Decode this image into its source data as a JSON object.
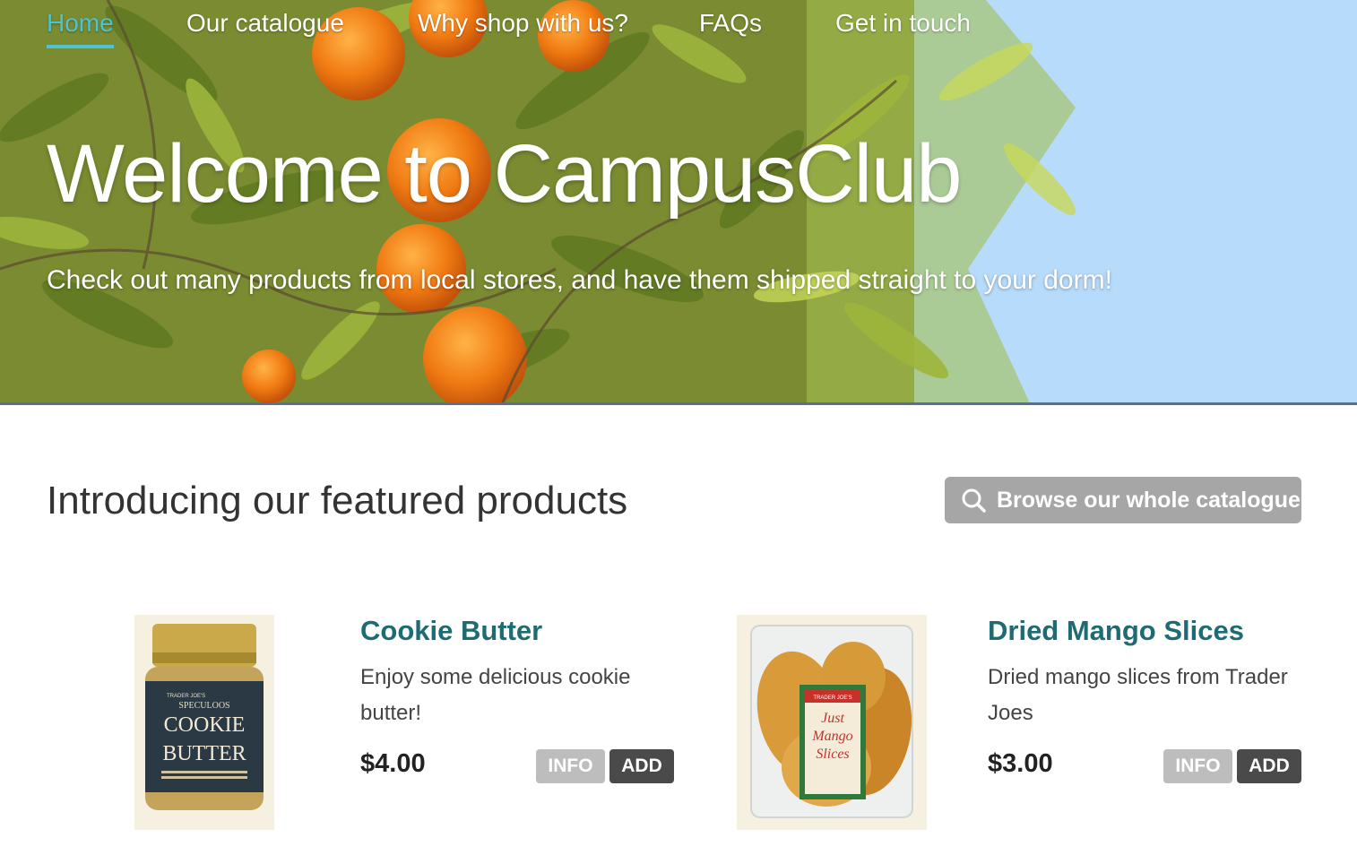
{
  "nav": {
    "items": [
      {
        "label": "Home",
        "active": true
      },
      {
        "label": "Our catalogue",
        "active": false
      },
      {
        "label": "Why shop with us?",
        "active": false
      },
      {
        "label": "FAQs",
        "active": false
      },
      {
        "label": "Get in touch",
        "active": false
      }
    ]
  },
  "hero": {
    "title": "Welcome to CampusClub",
    "subtitle": "Check out many products from local stores, and have them shipped straight to your dorm!"
  },
  "featured": {
    "heading": "Introducing our featured products",
    "browse_label": "Browse our whole catalogue",
    "browse_icon": "search-icon"
  },
  "products": [
    {
      "name": "Cookie Butter",
      "description": "Enjoy some delicious cookie butter!",
      "price": "$4.00",
      "info_label": "INFO",
      "add_label": "ADD",
      "image_labels": {
        "brand": "TRADER JOE'S",
        "top": "SPECULOOS",
        "line1": "COOKIE",
        "line2": "BUTTER"
      }
    },
    {
      "name": "Dried Mango Slices",
      "description": "Dried mango slices from Trader Joes",
      "price": "$3.00",
      "info_label": "INFO",
      "add_label": "ADD",
      "image_labels": {
        "brand": "TRADER JOE'S",
        "line1": "Just",
        "line2": "Mango",
        "line3": "Slices"
      }
    }
  ],
  "colors": {
    "accent": "#4ec3cf",
    "product_title": "#1f6b73",
    "browse_button": "#a6a6a6",
    "info_button": "#bdbdbd",
    "add_button": "#4a4a4a"
  }
}
